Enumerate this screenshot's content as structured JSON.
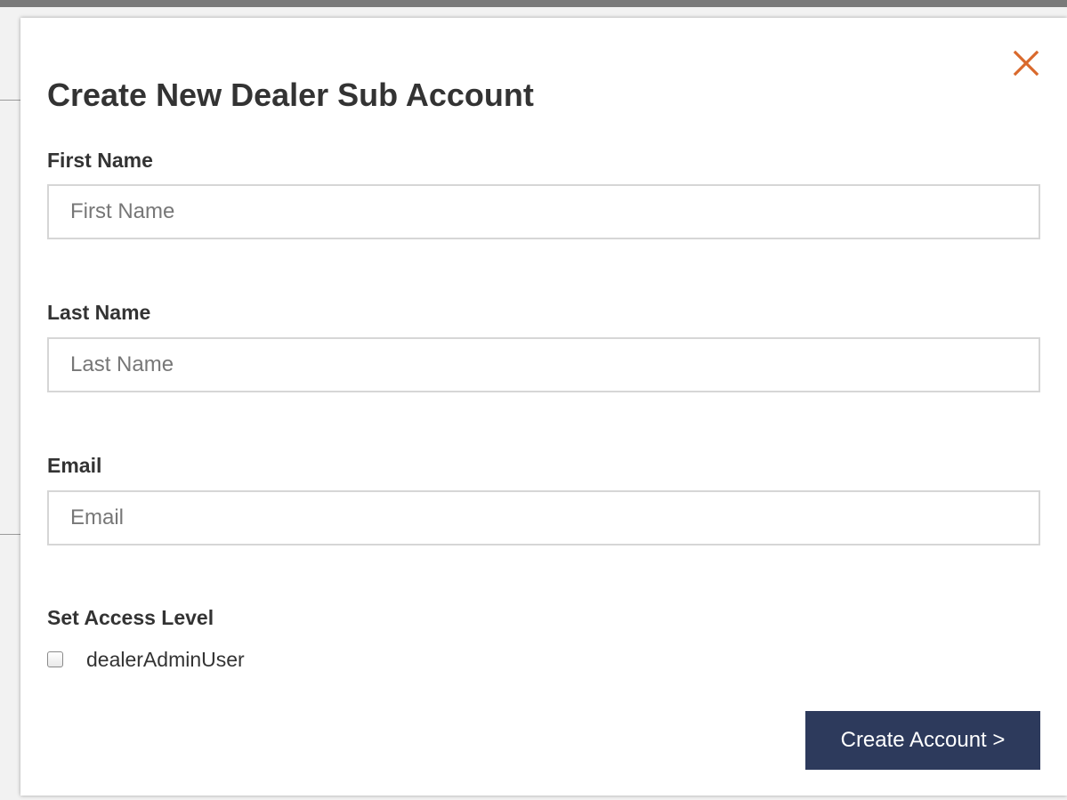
{
  "modal": {
    "title": "Create New Dealer Sub Account",
    "close_icon": "close-icon",
    "accent_color": "#d9692c",
    "fields": [
      {
        "label": "First Name",
        "placeholder": "First Name",
        "value": ""
      },
      {
        "label": "Last Name",
        "placeholder": "Last Name",
        "value": ""
      },
      {
        "label": "Email",
        "placeholder": "Email",
        "value": ""
      }
    ],
    "access": {
      "label": "Set Access Level",
      "options": [
        {
          "label": "dealerAdminUser",
          "checked": false
        }
      ]
    },
    "submit_label": "Create Account >",
    "submit_color": "#2d3a5c"
  }
}
